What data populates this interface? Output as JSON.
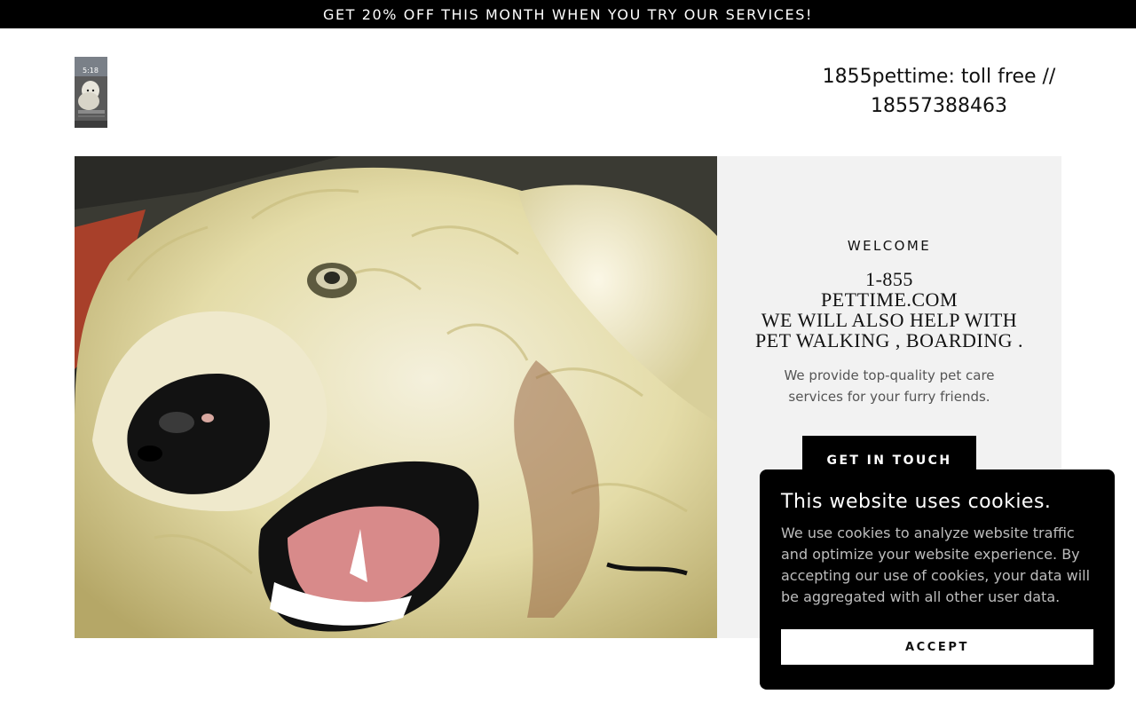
{
  "promo": {
    "text": "GET 20% OFF THIS MONTH WHEN YOU TRY OUR SERVICES!"
  },
  "header": {
    "logo_time": "5:18",
    "phone_line1": "1855pettime: toll free //",
    "phone_line2": "18557388463"
  },
  "hero": {
    "welcome": "WELCOME",
    "headline_lines": [
      "1-855",
      "PETTIME.COM",
      "WE WILL ALSO HELP WITH",
      "PET WALKING , BOARDING ."
    ],
    "tagline": "We provide top-quality pet care services for your furry friends.",
    "cta_label": "GET IN TOUCH"
  },
  "cookie": {
    "title": "This website uses cookies.",
    "text": "We use cookies to analyze website traffic and optimize your website experience. By accepting our use of cookies, your data will be aggregated with all other user data.",
    "accept_label": "ACCEPT"
  },
  "colors": {
    "promo_bg": "#000000",
    "panel_bg": "#f2f2f2",
    "button_bg": "#000000",
    "cookie_bg": "#000000"
  }
}
